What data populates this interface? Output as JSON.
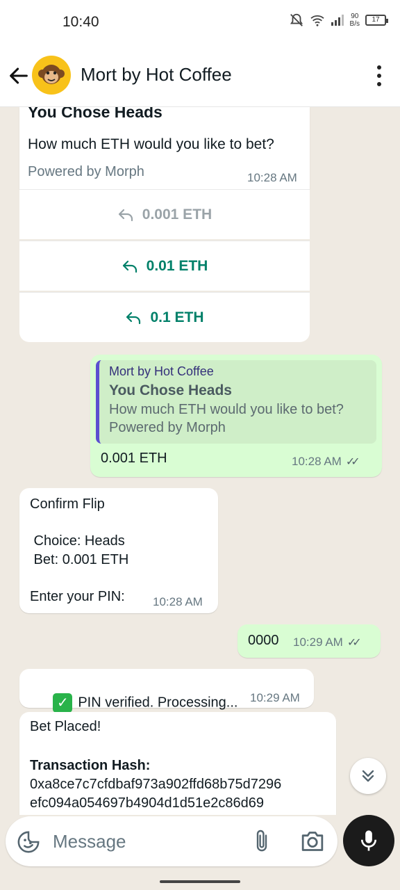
{
  "status_bar": {
    "time": "10:40",
    "net_speed_value": "90",
    "net_speed_unit": "B/s",
    "battery": "17"
  },
  "header": {
    "title": "Mort by Hot Coffee"
  },
  "messages": {
    "card": {
      "heading": "You Chose Heads",
      "body": "How much ETH would you like to bet?",
      "footer": "Powered by Morph",
      "time": "10:28 AM",
      "options": [
        "0.001 ETH",
        "0.01 ETH",
        "0.1 ETH"
      ]
    },
    "reply": {
      "quoted_sender": "Mort by Hot Coffee",
      "quoted_title": "You Chose Heads",
      "quoted_line1": "How much ETH would you like to bet?",
      "quoted_line2": "Powered by Morph",
      "text": "0.001 ETH",
      "time": "10:28 AM"
    },
    "confirm": {
      "text": "Confirm Flip\n\n Choice: Heads\n Bet: 0.001 ETH\n\nEnter your PIN:",
      "time": "10:28 AM"
    },
    "pin": {
      "text": "0000",
      "time": "10:29 AM"
    },
    "verified": {
      "text": "PIN verified. Processing...",
      "time": "10:29 AM"
    },
    "bet_placed": {
      "line1": "Bet Placed!",
      "label": "Transaction Hash:",
      "hash_line1": "0xa8ce7c7cfdbaf973a902ffd68b75d7296",
      "hash_line2": "efc094a054697b4904d1d51e2c86d69"
    }
  },
  "input": {
    "placeholder": "Message"
  },
  "colors": {
    "accent": "#008069",
    "outgoing_bubble": "#d9fdd3",
    "chat_background": "#efeae2",
    "avatar": "#f8c21a"
  }
}
